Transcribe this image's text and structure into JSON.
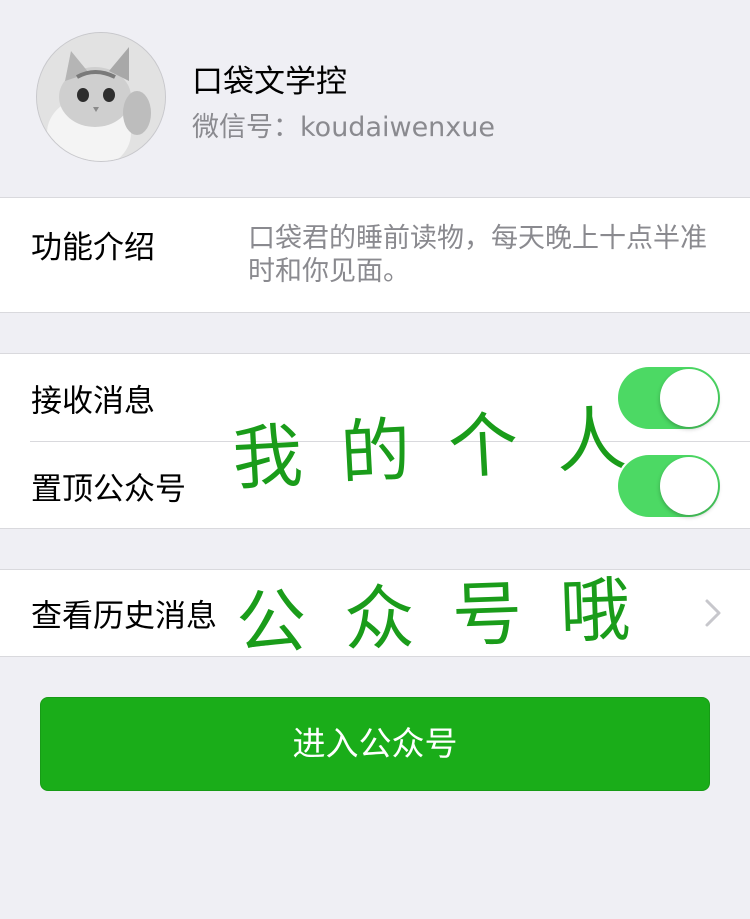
{
  "profile": {
    "name": "口袋文学控",
    "wechat_id_label": "微信号：koudaiwenxue"
  },
  "intro": {
    "label": "功能介绍",
    "text": "口袋君的睡前读物，每天晚上十点半准时和你见面。"
  },
  "settings": {
    "receive_messages": {
      "label": "接收消息",
      "enabled": true
    },
    "pin_to_top": {
      "label": "置顶公众号",
      "enabled": true
    }
  },
  "history": {
    "label": "查看历史消息"
  },
  "enter_button": {
    "label": "进入公众号"
  },
  "overlay": {
    "line1": "我的个人",
    "line2": "公众号哦"
  },
  "icons": {
    "chevron": "chevron-right-icon"
  },
  "colors": {
    "switch_on": "#4cd964",
    "button_green": "#1aad19",
    "handwriting": "#1a9c1a",
    "background": "#efeff4"
  }
}
